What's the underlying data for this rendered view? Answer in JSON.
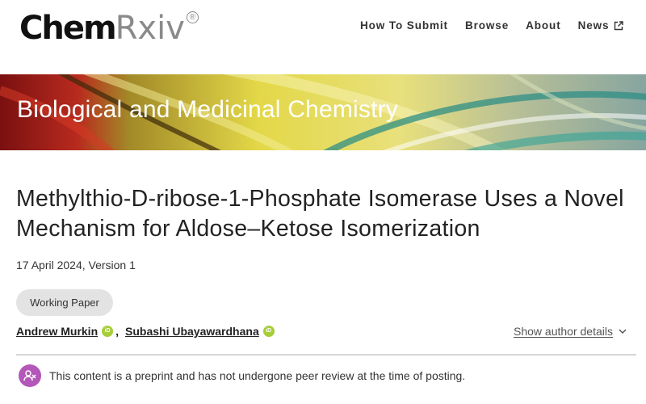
{
  "logo": {
    "primary": "Chem",
    "secondary": "Rxiv",
    "registered": "®"
  },
  "nav": {
    "items": [
      {
        "label": "How To Submit"
      },
      {
        "label": "Browse"
      },
      {
        "label": "About"
      },
      {
        "label": "News",
        "icon": "external-link-icon"
      }
    ]
  },
  "banner": {
    "title": "Biological and Medicinal Chemistry"
  },
  "article": {
    "title": "Methylthio-D-ribose-1-Phosphate Isomerase Uses a Novel Mechanism for Aldose–Ketose Isomerization",
    "date_version": "17 April 2024, Version 1",
    "tag": "Working Paper",
    "authors": [
      {
        "name": "Andrew Murkin",
        "icon": "orcid-icon"
      },
      {
        "name": "Subashi Ubayawardhana",
        "icon": "orcid-icon"
      }
    ],
    "author_separator": ",",
    "show_details": "Show author details",
    "notice": "This content is a preprint and has not undergone peer review at the time of posting."
  },
  "colors": {
    "orcid": "#a6ce39",
    "notice_icon": "#b357b8",
    "tag_bg": "#e3e3e3"
  }
}
